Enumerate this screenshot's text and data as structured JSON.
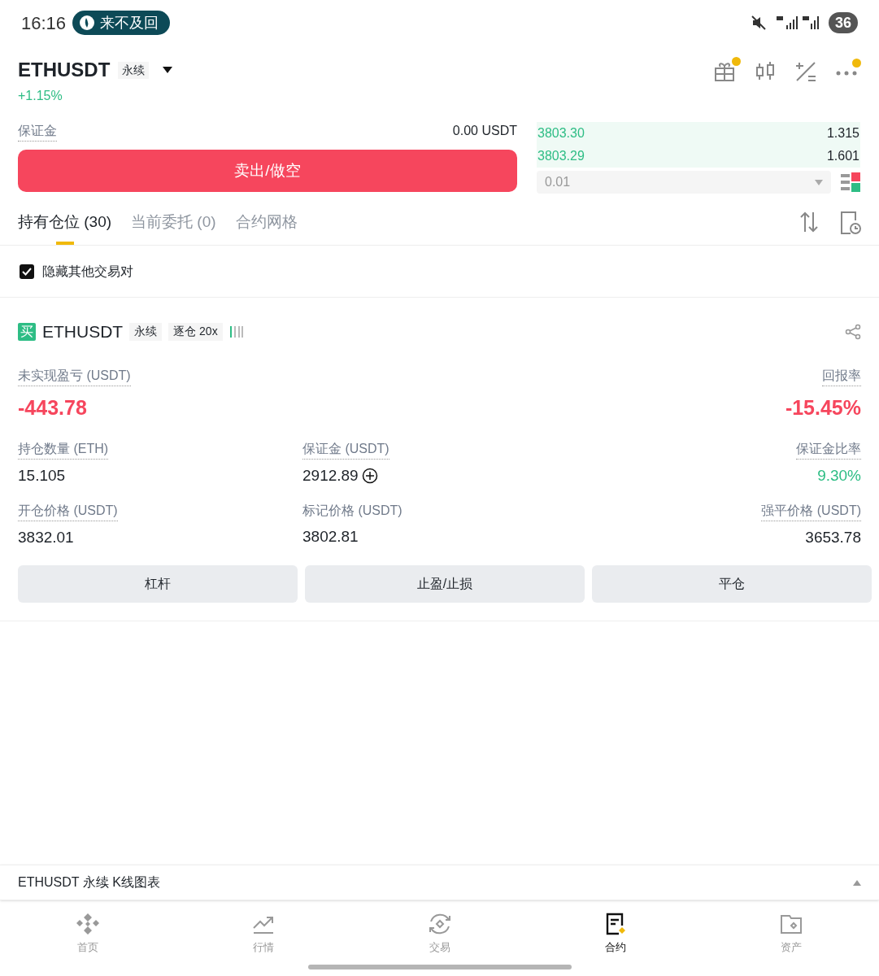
{
  "status_bar": {
    "time": "16:16",
    "notification": "来不及回",
    "battery": "36"
  },
  "header": {
    "symbol": "ETHUSDT",
    "tag": "永续",
    "change": "+1.15%"
  },
  "order_panel": {
    "margin_label": "保证金",
    "margin_value": "0.00 USDT",
    "sell_button": "卖出/做空"
  },
  "order_book": {
    "rows": [
      {
        "price": "3803.30",
        "qty": "1.315"
      },
      {
        "price": "3803.29",
        "qty": "1.601"
      }
    ],
    "depth": "0.01"
  },
  "tabs": [
    {
      "label": "持有仓位 (30)",
      "selected": true
    },
    {
      "label": "当前委托 (0)",
      "selected": false
    },
    {
      "label": "合约网格",
      "selected": false
    }
  ],
  "hide_other_pairs": {
    "label": "隐藏其他交易对",
    "checked": true
  },
  "position": {
    "side": "买",
    "symbol": "ETHUSDT",
    "tags": [
      "永续",
      "逐仓 20x"
    ],
    "pnl_label": "未实现盈亏 (USDT)",
    "pnl_value": "-443.78",
    "roe_label": "回报率",
    "roe_value": "-15.45%",
    "fields": [
      {
        "label": "持仓数量 (ETH)",
        "value": "15.105",
        "kind": "plain"
      },
      {
        "label": "保证金 (USDT)",
        "value": "2912.89",
        "kind": "adjustable"
      },
      {
        "label": "保证金比率",
        "value": "9.30%",
        "kind": "positive"
      },
      {
        "label": "开仓价格 (USDT)",
        "value": "3832.01",
        "kind": "plain"
      },
      {
        "label": "标记价格 (USDT)",
        "value": "3802.81",
        "kind": "plain"
      },
      {
        "label": "强平价格 (USDT)",
        "value": "3653.78",
        "kind": "plain"
      }
    ],
    "actions": [
      "杠杆",
      "止盈/止损",
      "平仓"
    ]
  },
  "chart_bar": {
    "title": "ETHUSDT 永续 K线图表"
  },
  "nav": [
    {
      "label": "首页",
      "selected": false
    },
    {
      "label": "行情",
      "selected": false
    },
    {
      "label": "交易",
      "selected": false
    },
    {
      "label": "合约",
      "selected": true
    },
    {
      "label": "资产",
      "selected": false
    }
  ]
}
